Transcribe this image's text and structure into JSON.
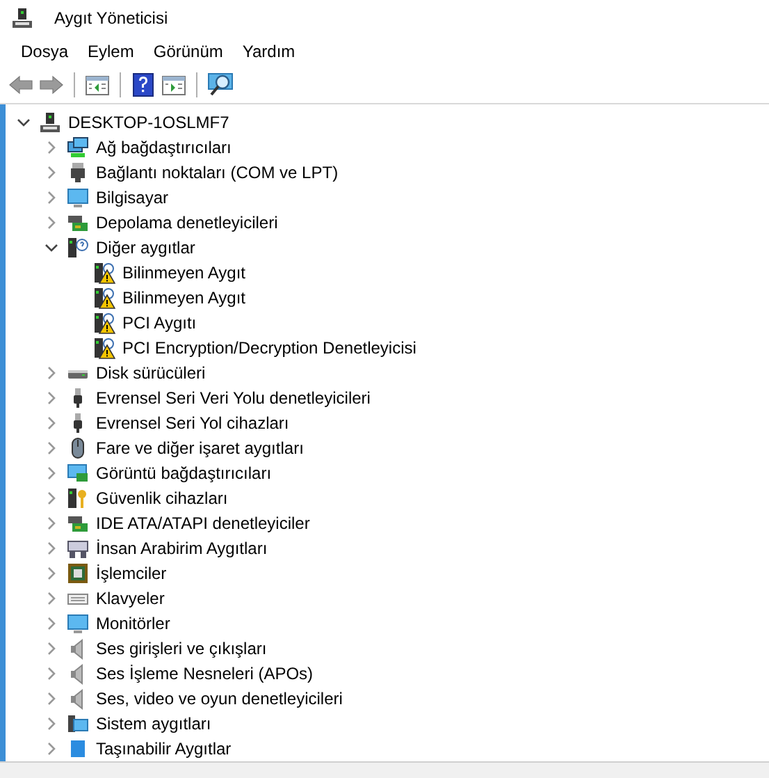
{
  "window": {
    "title": "Aygıt Yöneticisi"
  },
  "menu": [
    "Dosya",
    "Eylem",
    "Görünüm",
    "Yardım"
  ],
  "toolbar": [
    {
      "kind": "back",
      "disabled": true
    },
    {
      "kind": "forward",
      "disabled": true
    },
    {
      "kind": "separator"
    },
    {
      "kind": "pane"
    },
    {
      "kind": "separator"
    },
    {
      "kind": "help"
    },
    {
      "kind": "properties"
    },
    {
      "kind": "separator"
    },
    {
      "kind": "scan"
    }
  ],
  "tree": {
    "label": "DESKTOP-1OSLMF7",
    "expanded": true,
    "children": [
      {
        "label": "Ağ bağdaştırıcıları",
        "expanded": false
      },
      {
        "label": "Bağlantı noktaları (COM ve LPT)",
        "expanded": false
      },
      {
        "label": "Bilgisayar",
        "expanded": false
      },
      {
        "label": "Depolama denetleyicileri",
        "expanded": false
      },
      {
        "label": "Diğer aygıtlar",
        "expanded": true,
        "children": [
          {
            "label": "Bilinmeyen Aygıt",
            "warning": true
          },
          {
            "label": "Bilinmeyen Aygıt",
            "warning": true
          },
          {
            "label": "PCI Aygıtı",
            "warning": true
          },
          {
            "label": "PCI Encryption/Decryption Denetleyicisi",
            "warning": true
          }
        ]
      },
      {
        "label": "Disk sürücüleri",
        "expanded": false
      },
      {
        "label": "Evrensel Seri Veri Yolu denetleyicileri",
        "expanded": false
      },
      {
        "label": "Evrensel Seri Yol cihazları",
        "expanded": false
      },
      {
        "label": "Fare ve diğer işaret aygıtları",
        "expanded": false
      },
      {
        "label": "Görüntü bağdaştırıcıları",
        "expanded": false
      },
      {
        "label": "Güvenlik cihazları",
        "expanded": false
      },
      {
        "label": "IDE ATA/ATAPI denetleyiciler",
        "expanded": false
      },
      {
        "label": "İnsan Arabirim Aygıtları",
        "expanded": false
      },
      {
        "label": "İşlemciler",
        "expanded": false
      },
      {
        "label": "Klavyeler",
        "expanded": false
      },
      {
        "label": "Monitörler",
        "expanded": false
      },
      {
        "label": "Ses girişleri ve çıkışları",
        "expanded": false
      },
      {
        "label": "Ses İşleme Nesneleri (APOs)",
        "expanded": false
      },
      {
        "label": "Ses, video ve oyun denetleyicileri",
        "expanded": false
      },
      {
        "label": "Sistem aygıtları",
        "expanded": false
      },
      {
        "label": "Taşınabilir Aygıtlar",
        "expanded": false
      }
    ]
  }
}
